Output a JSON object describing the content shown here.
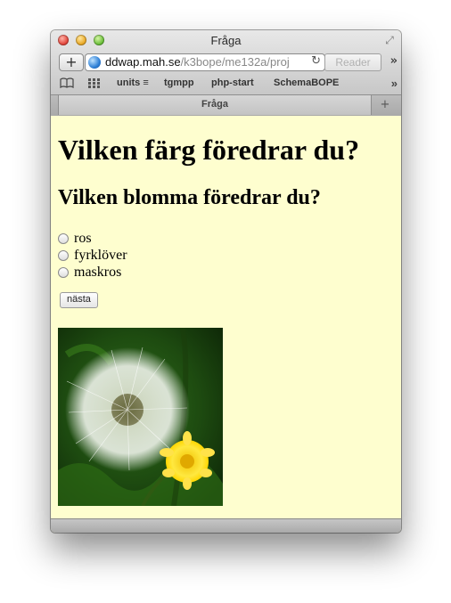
{
  "window": {
    "title": "Fråga"
  },
  "toolbar": {
    "new_tab_glyph": "+",
    "url_host": "ddwap.mah.se",
    "url_path": "/k3bope/me132a/proj",
    "reload_glyph": "↻",
    "reader_label": "Reader",
    "overflow_glyph": "»"
  },
  "bookmarks": {
    "items": [
      {
        "label": "units ≡"
      },
      {
        "label": "tgmpp"
      },
      {
        "label": "php-start"
      },
      {
        "label": "SchemaBOPE"
      }
    ],
    "overflow_glyph": "»"
  },
  "tabs": [
    {
      "label": "Fråga"
    }
  ],
  "page": {
    "heading": "Vilken färg föredrar du?",
    "question": "Vilken blomma föredrar du?",
    "options": [
      {
        "label": "ros",
        "selected": false
      },
      {
        "label": "fyrklöver",
        "selected": false
      },
      {
        "label": "maskros",
        "selected": false
      }
    ],
    "next_button": "nästa",
    "image_icon": "dandelion-photo"
  },
  "colors": {
    "page_background": "#fefecf",
    "heading_text": "#000000"
  }
}
